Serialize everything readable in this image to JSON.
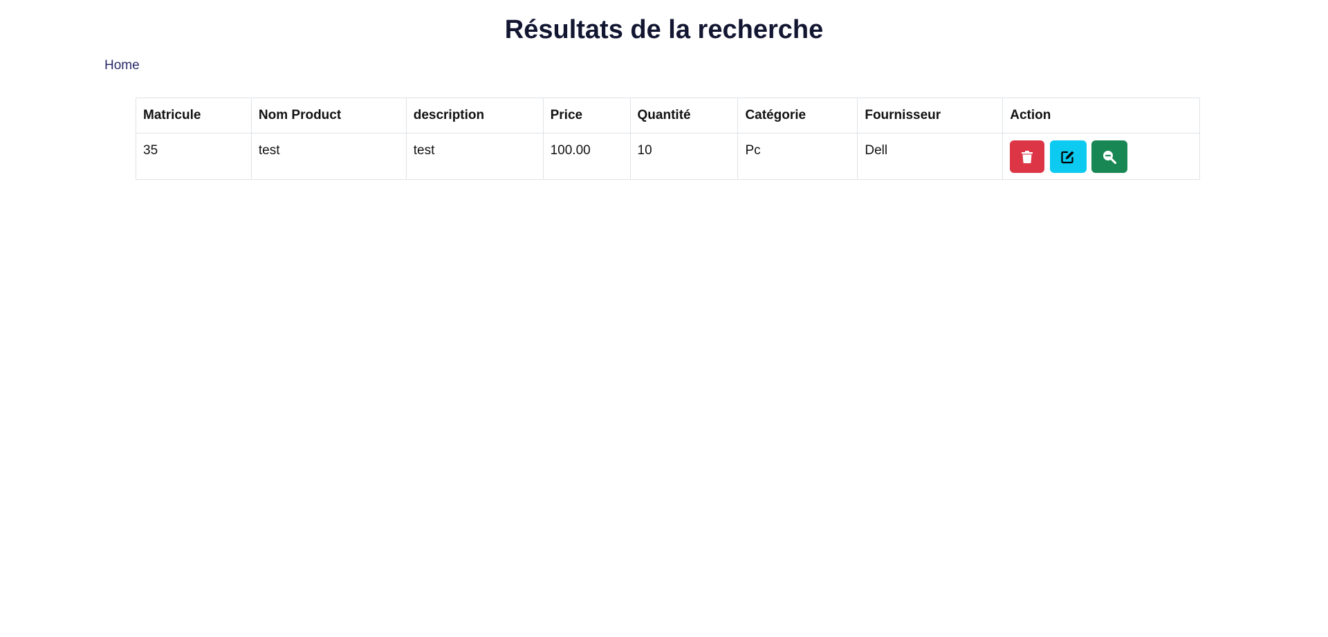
{
  "page": {
    "title": "Résultats de la recherche",
    "home_link": "Home"
  },
  "table": {
    "columns": [
      "Matricule",
      "Nom Product",
      "description",
      "Price",
      "Quantité",
      "Catégorie",
      "Fournisseur",
      "Action"
    ],
    "rows": [
      {
        "matricule": "35",
        "nom_product": "test",
        "description": "test",
        "price": "100.00",
        "quantite": "10",
        "categorie": "Pc",
        "fournisseur": "Dell"
      }
    ]
  },
  "actions": {
    "delete": {
      "icon": "trash-icon",
      "color": "#dc3545"
    },
    "edit": {
      "icon": "edit-icon",
      "color": "#0dcaf0"
    },
    "view": {
      "icon": "search-minus-icon",
      "color": "#198754"
    }
  }
}
